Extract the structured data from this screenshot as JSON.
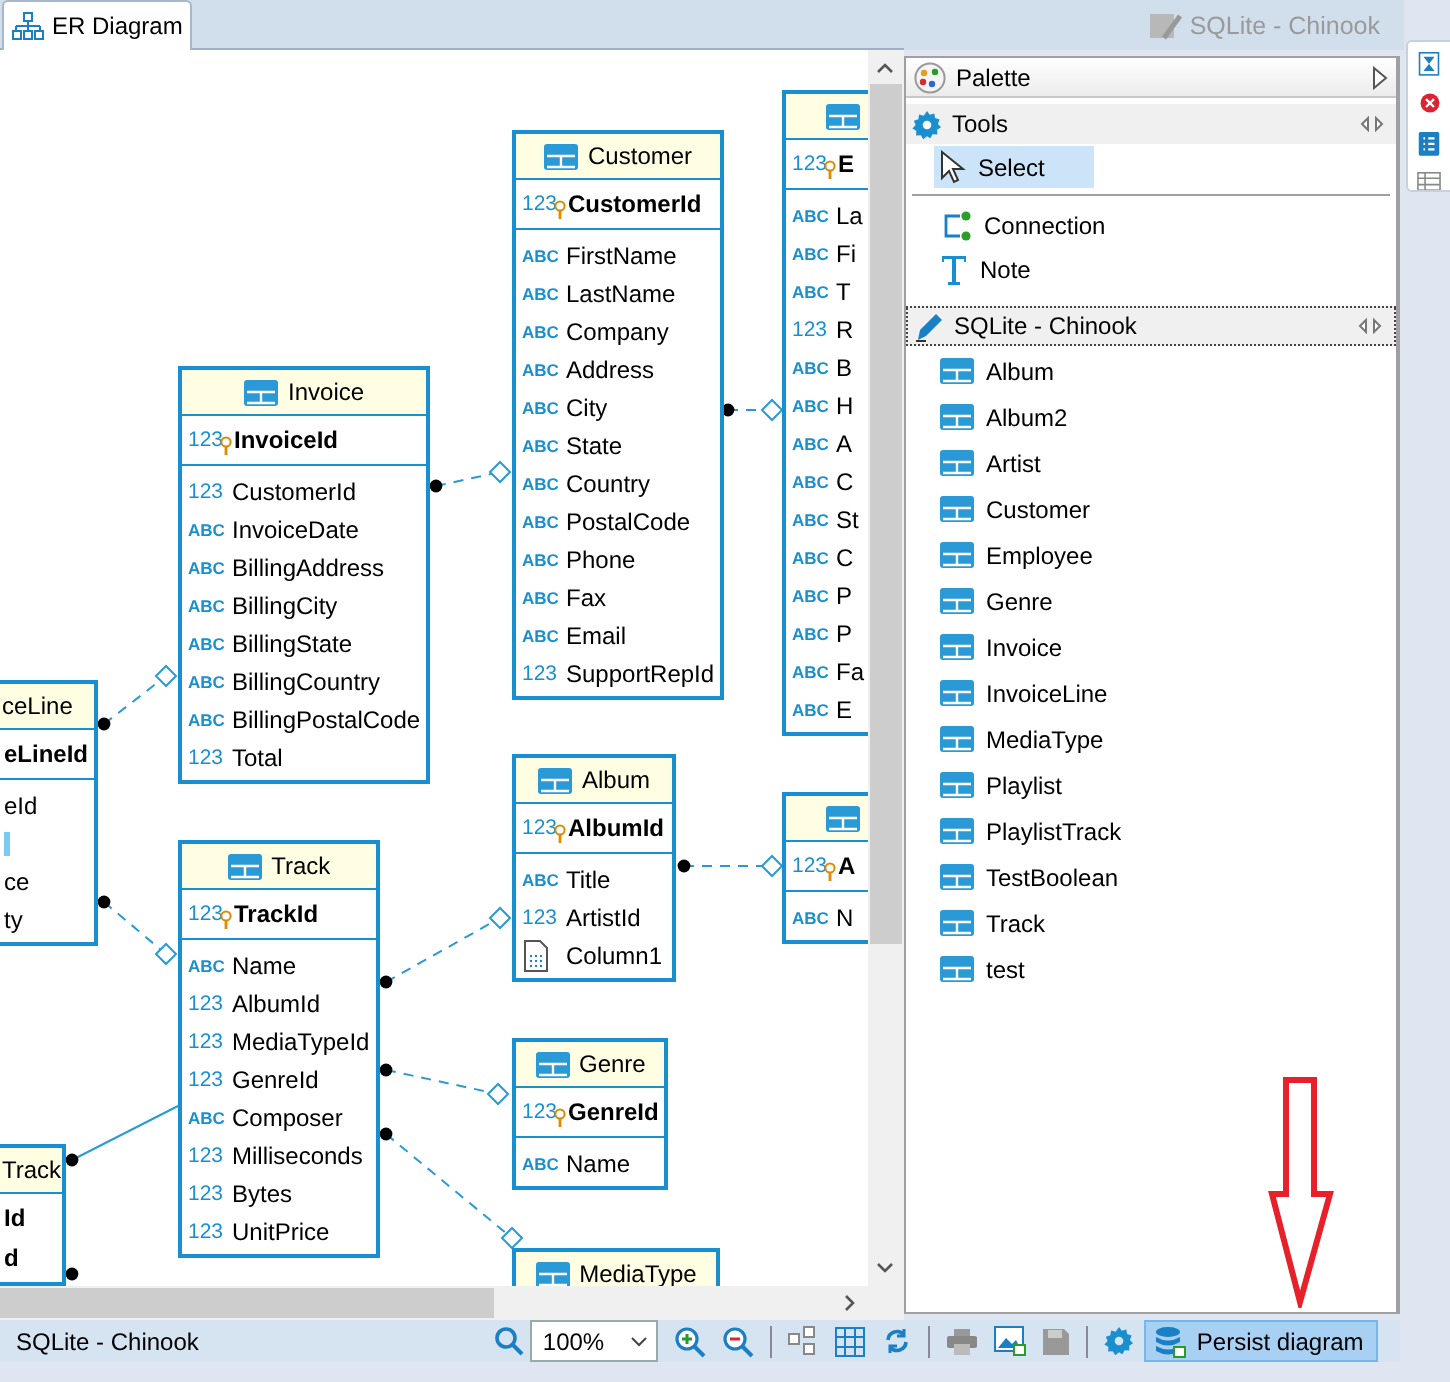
{
  "editor_tab": {
    "label": "ER Diagram",
    "selected": true
  },
  "header_title": "SQLite - Chinook",
  "tables": [
    {
      "name": "Customer",
      "keys": [
        {
          "kind": "number",
          "type_label": "123",
          "name": "CustomerId"
        }
      ],
      "columns": [
        {
          "kind": "text",
          "type_label": "ABC",
          "name": "FirstName"
        },
        {
          "kind": "text",
          "type_label": "ABC",
          "name": "LastName"
        },
        {
          "kind": "text",
          "type_label": "ABC",
          "name": "Company"
        },
        {
          "kind": "text",
          "type_label": "ABC",
          "name": "Address"
        },
        {
          "kind": "text",
          "type_label": "ABC",
          "name": "City"
        },
        {
          "kind": "text",
          "type_label": "ABC",
          "name": "State"
        },
        {
          "kind": "text",
          "type_label": "ABC",
          "name": "Country"
        },
        {
          "kind": "text",
          "type_label": "ABC",
          "name": "PostalCode"
        },
        {
          "kind": "text",
          "type_label": "ABC",
          "name": "Phone"
        },
        {
          "kind": "text",
          "type_label": "ABC",
          "name": "Fax"
        },
        {
          "kind": "text",
          "type_label": "ABC",
          "name": "Email"
        },
        {
          "kind": "number",
          "type_label": "123",
          "name": "SupportRepId"
        }
      ]
    },
    {
      "keys": [
        {
          "kind": "number",
          "type_label": "123",
          "name": "E"
        }
      ],
      "columns": [
        {
          "kind": "text",
          "type_label": "ABC",
          "name": "La"
        },
        {
          "kind": "text",
          "type_label": "ABC",
          "name": "Fi"
        },
        {
          "kind": "text",
          "type_label": "ABC",
          "name": "T"
        },
        {
          "kind": "number",
          "type_label": "123",
          "name": "R"
        },
        {
          "kind": "text",
          "type_label": "ABC",
          "name": "B"
        },
        {
          "kind": "text",
          "type_label": "ABC",
          "name": "H"
        },
        {
          "kind": "text",
          "type_label": "ABC",
          "name": "A"
        },
        {
          "kind": "text",
          "type_label": "ABC",
          "name": "C"
        },
        {
          "kind": "text",
          "type_label": "ABC",
          "name": "St"
        },
        {
          "kind": "text",
          "type_label": "ABC",
          "name": "C"
        },
        {
          "kind": "text",
          "type_label": "ABC",
          "name": "P"
        },
        {
          "kind": "text",
          "type_label": "ABC",
          "name": "P"
        },
        {
          "kind": "text",
          "type_label": "ABC",
          "name": "Fa"
        },
        {
          "kind": "text",
          "type_label": "ABC",
          "name": "E"
        }
      ]
    },
    {
      "name": "Invoice",
      "keys": [
        {
          "kind": "number",
          "type_label": "123",
          "name": "InvoiceId"
        }
      ],
      "columns": [
        {
          "kind": "number",
          "type_label": "123",
          "name": "CustomerId"
        },
        {
          "kind": "text",
          "type_label": "ABC",
          "name": "InvoiceDate"
        },
        {
          "kind": "text",
          "type_label": "ABC",
          "name": "BillingAddress"
        },
        {
          "kind": "text",
          "type_label": "ABC",
          "name": "BillingCity"
        },
        {
          "kind": "text",
          "type_label": "ABC",
          "name": "BillingState"
        },
        {
          "kind": "text",
          "type_label": "ABC",
          "name": "BillingCountry"
        },
        {
          "kind": "text",
          "type_label": "ABC",
          "name": "BillingPostalCode"
        },
        {
          "kind": "number",
          "type_label": "123",
          "name": "Total"
        }
      ]
    },
    {
      "name": "ceLine",
      "keys": [
        {
          "kind": "cut",
          "name": "eLineId"
        }
      ],
      "columns": [
        {
          "kind": "cut",
          "name": "eId"
        },
        {
          "kind": "fragment"
        },
        {
          "kind": "cut",
          "name": "ce"
        },
        {
          "kind": "cut",
          "name": "ty"
        }
      ]
    },
    {
      "name": "Track",
      "keys": [
        {
          "kind": "number",
          "type_label": "123",
          "name": "TrackId"
        }
      ],
      "columns": [
        {
          "kind": "text",
          "type_label": "ABC",
          "name": "Name"
        },
        {
          "kind": "number",
          "type_label": "123",
          "name": "AlbumId"
        },
        {
          "kind": "number",
          "type_label": "123",
          "name": "MediaTypeId"
        },
        {
          "kind": "number",
          "type_label": "123",
          "name": "GenreId"
        },
        {
          "kind": "text",
          "type_label": "ABC",
          "name": "Composer"
        },
        {
          "kind": "number",
          "type_label": "123",
          "name": "Milliseconds"
        },
        {
          "kind": "number",
          "type_label": "123",
          "name": "Bytes"
        },
        {
          "kind": "number",
          "type_label": "123",
          "name": "UnitPrice"
        }
      ]
    },
    {
      "name": "Album",
      "keys": [
        {
          "kind": "number",
          "type_label": "123",
          "name": "AlbumId"
        }
      ],
      "columns": [
        {
          "kind": "text",
          "type_label": "ABC",
          "name": "Title"
        },
        {
          "kind": "number",
          "type_label": "123",
          "name": "ArtistId"
        },
        {
          "kind": "blob",
          "name": "Column1"
        }
      ]
    },
    {
      "keys": [
        {
          "kind": "number",
          "type_label": "123",
          "name": "A"
        }
      ],
      "columns": [
        {
          "kind": "text",
          "type_label": "ABC",
          "name": "N"
        }
      ]
    },
    {
      "name": "Genre",
      "keys": [
        {
          "kind": "number",
          "type_label": "123",
          "name": "GenreId"
        }
      ],
      "columns": [
        {
          "kind": "text",
          "type_label": "ABC",
          "name": "Name"
        }
      ]
    },
    {
      "name": "Track",
      "keys": [
        {
          "kind": "cut",
          "name": "Id"
        },
        {
          "kind": "cut",
          "name": "d"
        }
      ]
    },
    {
      "name": "MediaType"
    }
  ],
  "palette": {
    "title": "Palette",
    "groups": [
      {
        "title": "Tools",
        "kind": "tools",
        "items": [
          {
            "label": "Select",
            "kind": "pointer",
            "selected": true
          },
          {
            "label": "Connection",
            "kind": "connection",
            "selected": false
          },
          {
            "label": "Note",
            "kind": "note",
            "selected": false
          }
        ]
      },
      {
        "title": "SQLite - Chinook",
        "kind": "database",
        "items": [
          {
            "label": "Album",
            "kind": "table",
            "selected": false
          },
          {
            "label": "Album2",
            "kind": "table",
            "selected": false
          },
          {
            "label": "Artist",
            "kind": "table",
            "selected": false
          },
          {
            "label": "Customer",
            "kind": "table",
            "selected": false
          },
          {
            "label": "Employee",
            "kind": "table",
            "selected": false
          },
          {
            "label": "Genre",
            "kind": "table",
            "selected": false
          },
          {
            "label": "Invoice",
            "kind": "table",
            "selected": false
          },
          {
            "label": "InvoiceLine",
            "kind": "table",
            "selected": false
          },
          {
            "label": "MediaType",
            "kind": "table",
            "selected": false
          },
          {
            "label": "Playlist",
            "kind": "table",
            "selected": false
          },
          {
            "label": "PlaylistTrack",
            "kind": "table",
            "selected": false
          },
          {
            "label": "TestBoolean",
            "kind": "table",
            "selected": false
          },
          {
            "label": "Track",
            "kind": "table",
            "selected": false
          },
          {
            "label": "test",
            "kind": "table",
            "selected": false
          }
        ]
      }
    ]
  },
  "status_bar": {
    "connection": "SQLite - Chinook",
    "zoom": "100%",
    "persist_button": {
      "label": "Persist diagram",
      "selected": true
    }
  }
}
